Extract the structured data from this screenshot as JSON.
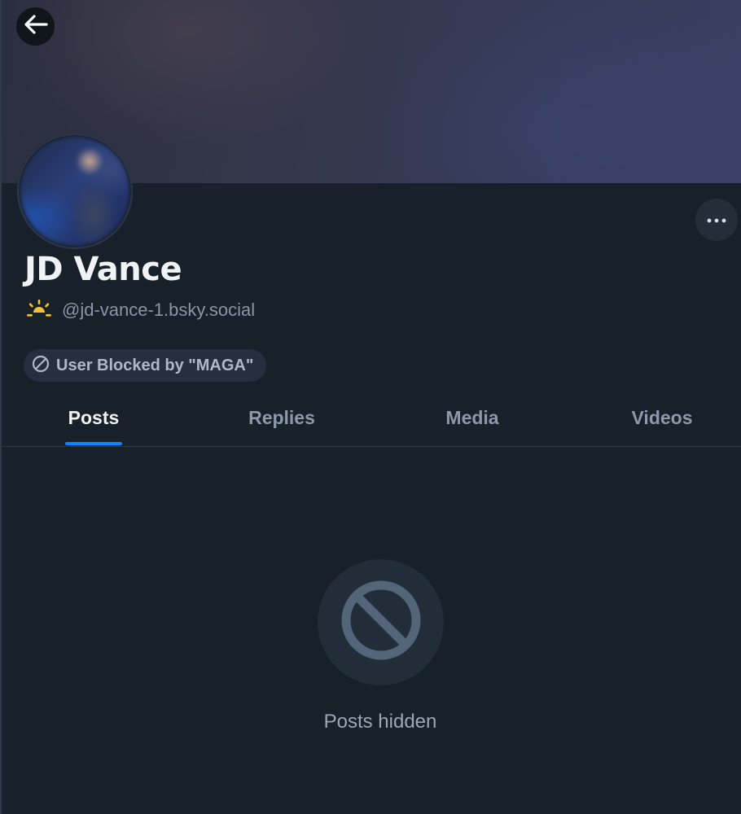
{
  "profile": {
    "display_name": "JD Vance",
    "handle": "@jd-vance-1.bsky.social",
    "handle_badge_icon": "sunrise-icon",
    "blocked_label": "User Blocked by \"MAGA\""
  },
  "header": {
    "back_icon": "arrow-left-icon",
    "more_icon": "ellipsis-icon"
  },
  "tabs": [
    {
      "label": "Posts",
      "active": true
    },
    {
      "label": "Replies",
      "active": false
    },
    {
      "label": "Media",
      "active": false
    },
    {
      "label": "Videos",
      "active": false
    }
  ],
  "empty_state": {
    "icon": "prohibited-icon",
    "message": "Posts hidden"
  },
  "colors": {
    "background": "#18202a",
    "accent": "#1083fe",
    "badge_yellow": "#f5c12e",
    "muted_text": "#8796a8"
  }
}
